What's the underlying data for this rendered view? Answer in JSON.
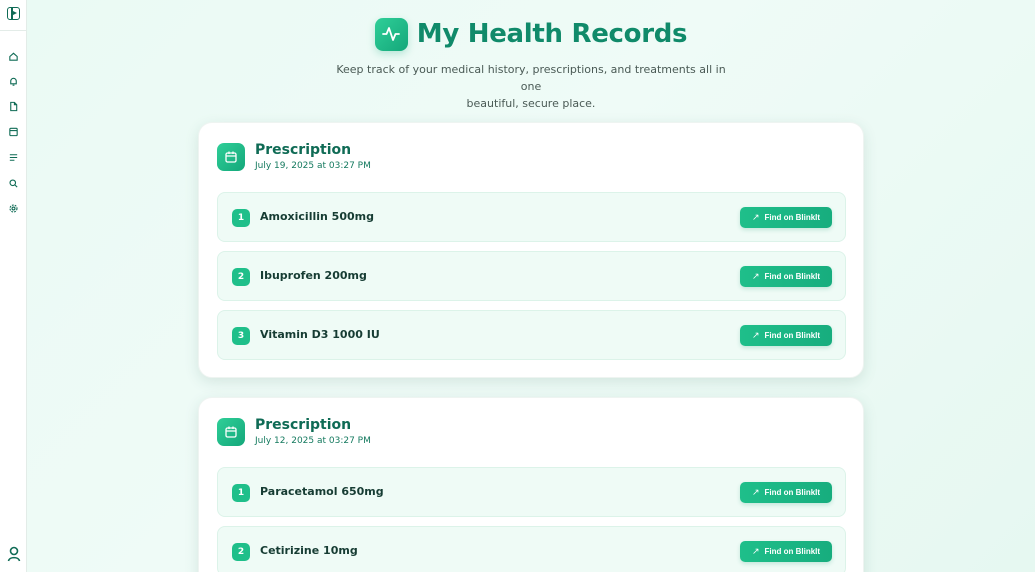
{
  "header": {
    "title": "My Health Records",
    "subtitle_line1": "Keep track of your medical history, prescriptions, and treatments all in one",
    "subtitle_line2": "beautiful, secure place."
  },
  "sidebar": {
    "items": [
      {
        "icon": "home-icon"
      },
      {
        "icon": "bell-icon"
      },
      {
        "icon": "file-icon"
      },
      {
        "icon": "calendar-icon"
      },
      {
        "icon": "list-icon"
      },
      {
        "icon": "search-icon"
      },
      {
        "icon": "gear-icon"
      }
    ],
    "user_icon": "user-icon"
  },
  "prescriptions": [
    {
      "title": "Prescription",
      "date": "July 19, 2025 at 03:27 PM",
      "medicines": [
        {
          "num": "1",
          "name": "Amoxicillin 500mg",
          "button": "Find on BlinkIt"
        },
        {
          "num": "2",
          "name": "Ibuprofen 200mg",
          "button": "Find on BlinkIt"
        },
        {
          "num": "3",
          "name": "Vitamin D3 1000 IU",
          "button": "Find on BlinkIt"
        }
      ]
    },
    {
      "title": "Prescription",
      "date": "July 12, 2025 at 03:27 PM",
      "medicines": [
        {
          "num": "1",
          "name": "Paracetamol 650mg",
          "button": "Find on BlinkIt"
        },
        {
          "num": "2",
          "name": "Cetirizine 10mg",
          "button": "Find on BlinkIt"
        }
      ]
    }
  ],
  "colors": {
    "accent": "#1fbf8a",
    "title": "#108a6a",
    "dark_green": "#0f6b55"
  }
}
